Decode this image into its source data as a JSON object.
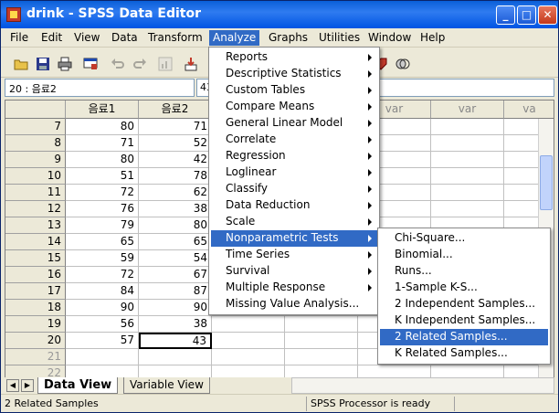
{
  "window": {
    "title": "drink - SPSS Data Editor"
  },
  "menubar": [
    "File",
    "Edit",
    "View",
    "Data",
    "Transform",
    "Analyze",
    "Graphs",
    "Utilities",
    "Window",
    "Help"
  ],
  "cell_editor": {
    "ref": "20 : 음료2",
    "value": "43"
  },
  "columns": [
    "음료1",
    "음료2",
    "var",
    "var",
    "var",
    "va"
  ],
  "rows": [
    {
      "n": "7",
      "a": "80",
      "b": "71"
    },
    {
      "n": "8",
      "a": "71",
      "b": "52"
    },
    {
      "n": "9",
      "a": "80",
      "b": "42"
    },
    {
      "n": "10",
      "a": "51",
      "b": "78"
    },
    {
      "n": "11",
      "a": "72",
      "b": "62"
    },
    {
      "n": "12",
      "a": "76",
      "b": "38"
    },
    {
      "n": "13",
      "a": "79",
      "b": "80"
    },
    {
      "n": "14",
      "a": "65",
      "b": "65"
    },
    {
      "n": "15",
      "a": "59",
      "b": "54"
    },
    {
      "n": "16",
      "a": "72",
      "b": "67"
    },
    {
      "n": "17",
      "a": "84",
      "b": "87"
    },
    {
      "n": "18",
      "a": "90",
      "b": "90"
    },
    {
      "n": "19",
      "a": "56",
      "b": "38"
    },
    {
      "n": "20",
      "a": "57",
      "b": "43"
    },
    {
      "n": "21",
      "a": "",
      "b": ""
    },
    {
      "n": "22",
      "a": "",
      "b": ""
    }
  ],
  "analyze_menu": [
    {
      "label": "Reports",
      "submenu": true
    },
    {
      "label": "Descriptive Statistics",
      "submenu": true
    },
    {
      "label": "Custom Tables",
      "submenu": true
    },
    {
      "label": "Compare Means",
      "submenu": true
    },
    {
      "label": "General Linear Model",
      "submenu": true
    },
    {
      "label": "Correlate",
      "submenu": true
    },
    {
      "label": "Regression",
      "submenu": true
    },
    {
      "label": "Loglinear",
      "submenu": true
    },
    {
      "label": "Classify",
      "submenu": true
    },
    {
      "label": "Data Reduction",
      "submenu": true
    },
    {
      "label": "Scale",
      "submenu": true
    },
    {
      "label": "Nonparametric Tests",
      "submenu": true,
      "highlighted": true
    },
    {
      "label": "Time Series",
      "submenu": true
    },
    {
      "label": "Survival",
      "submenu": true
    },
    {
      "label": "Multiple Response",
      "submenu": true
    },
    {
      "label": "Missing Value Analysis...",
      "submenu": false
    }
  ],
  "nonparametric_menu": [
    {
      "label": "Chi-Square..."
    },
    {
      "label": "Binomial..."
    },
    {
      "label": "Runs..."
    },
    {
      "label": "1-Sample K-S..."
    },
    {
      "label": "2 Independent Samples..."
    },
    {
      "label": "K Independent Samples..."
    },
    {
      "label": "2 Related Samples...",
      "highlighted": true
    },
    {
      "label": "K Related Samples..."
    }
  ],
  "tabs": {
    "data_view": "Data View",
    "variable_view": "Variable View"
  },
  "status": {
    "left": "2 Related Samples",
    "processor": "SPSS Processor  is ready"
  },
  "colors": {
    "title_blue": "#0054e3",
    "highlight": "#316ac5",
    "chrome": "#ece9d8"
  }
}
